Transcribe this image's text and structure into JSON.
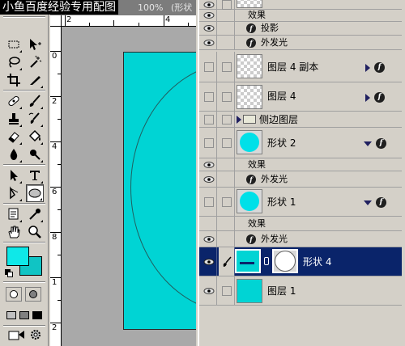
{
  "watermark": "小鱼百度经验专用配图",
  "document": {
    "zoom": "100%",
    "mode_fragment": "(形状",
    "hruler_numbers": [
      "2",
      "4"
    ],
    "vruler_numbers": [
      "0",
      "2",
      "4",
      "6",
      "8",
      "1",
      "2"
    ]
  },
  "colors": {
    "foreground": "#0fe8e8",
    "background": "#10c4c4",
    "selection": "#0a246a",
    "canvas": "#00d4d4"
  },
  "tools": [
    "marquee-tool",
    "move-tool",
    "lasso-tool",
    "magic-wand-tool",
    "crop-tool",
    "slice-tool",
    "healing-brush-tool",
    "brush-tool",
    "clone-stamp-tool",
    "history-brush-tool",
    "eraser-tool",
    "paint-bucket-tool",
    "blur-tool",
    "dodge-tool",
    "path-selection-tool",
    "type-tool",
    "pen-tool",
    "ellipse-tool",
    "notes-tool",
    "eyedropper-tool",
    "hand-tool",
    "zoom-tool"
  ],
  "layers": {
    "effects_label": "效果",
    "top_effects": {
      "label": "效果",
      "items": [
        "投影",
        "外发光"
      ]
    },
    "items": [
      {
        "name": "图层 4 副本"
      },
      {
        "name": "图层 4"
      },
      {
        "name": "侧边图层"
      },
      {
        "name": "形状 2",
        "effects": [
          "外发光"
        ]
      },
      {
        "name": "形状 1",
        "effects": [
          "外发光"
        ]
      },
      {
        "name": "形状 4"
      },
      {
        "name": "图层 1"
      }
    ]
  }
}
